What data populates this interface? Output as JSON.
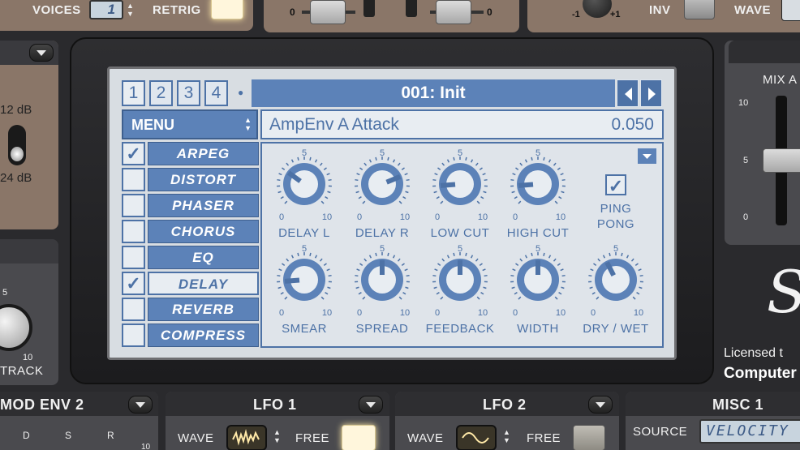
{
  "top_bar": {
    "voices_label": "VOICES",
    "voices_value": "1",
    "retrig_label": "RETRIG",
    "slider_min_left": "0",
    "slider_min_right": "0",
    "knob_min": "-1",
    "knob_max": "+1",
    "inv_label": "INV",
    "wave_label": "WAVE"
  },
  "left_panel": {
    "opt_12db": "12 dB",
    "opt_24db": "24 dB",
    "knob_tick_top": "5",
    "knob_tick_bottom": "10",
    "track_label": "TRACK"
  },
  "right_panel": {
    "mix_label": "MIX A",
    "tick_10": "10",
    "tick_5": "5",
    "tick_0": "0",
    "logo_glyph": "S",
    "licensed_label": "Licensed t",
    "licensee": "Computer"
  },
  "lcd": {
    "tabs": [
      "1",
      "2",
      "3",
      "4"
    ],
    "bullet": "●",
    "patch_name": "001: Init",
    "menu_label": "MENU",
    "param_name": "AmpEnv A Attack",
    "param_value": "0.050",
    "menu_items": [
      {
        "label": "ARPEG",
        "checked": true
      },
      {
        "label": "DISTORT",
        "checked": false
      },
      {
        "label": "PHASER",
        "checked": false
      },
      {
        "label": "CHORUS",
        "checked": false
      },
      {
        "label": "EQ",
        "checked": false
      },
      {
        "label": "DELAY",
        "checked": true
      },
      {
        "label": "REVERB",
        "checked": false
      },
      {
        "label": "COMPRESS",
        "checked": false
      }
    ],
    "knob_tick_min": "0",
    "knob_tick_mid": "5",
    "knob_tick_max": "10",
    "knobs_row1": [
      {
        "label": "DELAY L",
        "value": 3
      },
      {
        "label": "DELAY R",
        "value": 7.5
      },
      {
        "label": "LOW CUT",
        "value": 1.5
      },
      {
        "label": "HIGH CUT",
        "value": 1.5
      }
    ],
    "ping_pong_label_1": "PING",
    "ping_pong_label_2": "PONG",
    "knobs_row2": [
      {
        "label": "SMEAR",
        "value": 1.5
      },
      {
        "label": "SPREAD",
        "value": 5
      },
      {
        "label": "FEEDBACK",
        "value": 5
      },
      {
        "label": "WIDTH",
        "value": 5
      },
      {
        "label": "DRY / WET",
        "value": 4
      }
    ]
  },
  "bottom": {
    "mod_env_title": "MOD ENV 2",
    "mod_env_d": "D",
    "mod_env_s": "S",
    "mod_env_r": "R",
    "mod_env_tick": "10",
    "lfo1_title": "LFO 1",
    "lfo1_wave": "WAVE",
    "lfo1_free": "FREE",
    "lfo2_title": "LFO 2",
    "lfo2_wave": "WAVE",
    "lfo2_free": "FREE",
    "misc_title": "MISC 1",
    "misc_source": "SOURCE",
    "misc_source_value": "VELOCITY"
  },
  "colors": {
    "lcd_blue": "#4d72a6",
    "lcd_bg": "#d8dde2",
    "panel_tan": "#8a7668"
  }
}
